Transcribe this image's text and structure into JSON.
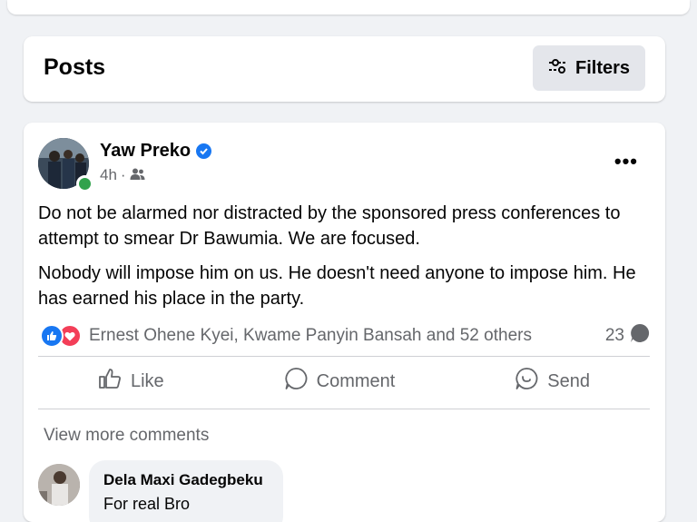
{
  "posts_header": {
    "title": "Posts",
    "filters_label": "Filters"
  },
  "post": {
    "author": "Yaw Preko",
    "verified": true,
    "time": "4h",
    "privacy_icon": "friends-icon",
    "paragraphs": [
      "Do not be alarmed nor distracted by the sponsored press conferences to attempt to smear Dr Bawumia. We are focused.",
      "Nobody will impose him on us. He doesn't need anyone to impose him. He has earned his place in the party."
    ],
    "reactions": {
      "types": [
        "like",
        "love"
      ],
      "summary": "Ernest Ohene Kyei, Kwame Panyin Bansah and 52 others",
      "comments_count": "23"
    },
    "actions": {
      "like": "Like",
      "comment": "Comment",
      "send": "Send"
    },
    "view_more_comments": "View more comments",
    "comment": {
      "author": "Dela Maxi Gadegbeku",
      "text": "For real Bro"
    }
  },
  "colors": {
    "accent": "#1877f2",
    "love": "#f33e58",
    "online": "#31a24c",
    "secondary_text": "#65676b",
    "background": "#f0f2f5"
  }
}
